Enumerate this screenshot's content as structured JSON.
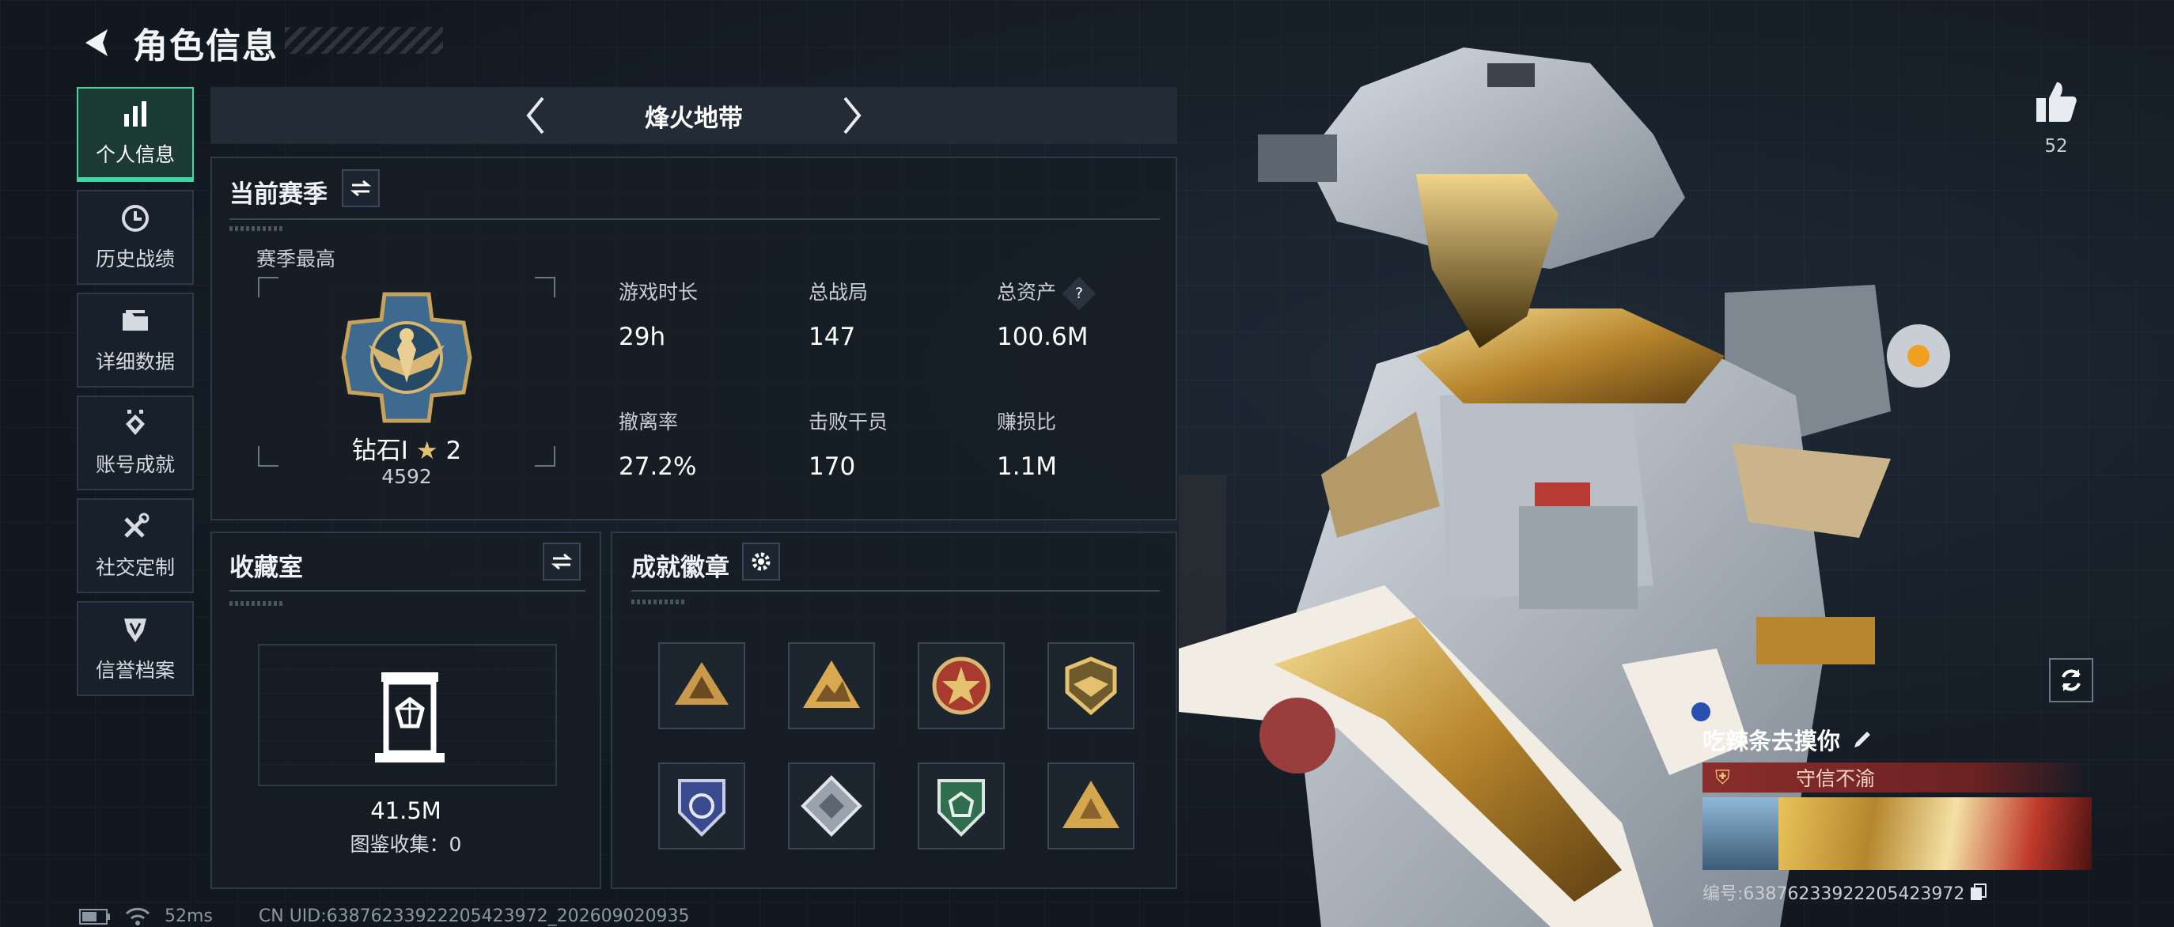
{
  "header": {
    "title": "角色信息"
  },
  "sidebar": {
    "items": [
      {
        "label": "个人信息",
        "icon": "bar-chart-icon",
        "active": true
      },
      {
        "label": "历史战绩",
        "icon": "history-icon"
      },
      {
        "label": "详细数据",
        "icon": "folder-icon"
      },
      {
        "label": "账号成就",
        "icon": "achievement-icon"
      },
      {
        "label": "社交定制",
        "icon": "tools-icon"
      },
      {
        "label": "信誉档案",
        "icon": "shield-icon"
      }
    ]
  },
  "mode": {
    "name": "烽火地带"
  },
  "season": {
    "title": "当前赛季",
    "best_label": "赛季最高",
    "rank_name": "钻石Ⅰ",
    "rank_stars": "2",
    "rank_score": "4592",
    "stats": [
      {
        "label": "游戏时长",
        "value": "29h"
      },
      {
        "label": "总战局",
        "value": "147"
      },
      {
        "label": "总资产",
        "value": "100.6M"
      },
      {
        "label": "撤离率",
        "value": "27.2%"
      },
      {
        "label": "击败干员",
        "value": "170"
      },
      {
        "label": "赚损比",
        "value": "1.1M"
      }
    ],
    "help_glyph": "?"
  },
  "collection": {
    "title": "收藏室",
    "value": "41.5M",
    "codex_text": "图鉴收集：0"
  },
  "achievements": {
    "title": "成就徽章",
    "badges": [
      "triangle-badge-icon",
      "mountain-badge-icon",
      "star-emblem-icon",
      "gold-wing-badge-icon",
      "blue-shield-badge-icon",
      "diamond-badge-icon",
      "green-shield-badge-icon",
      "gold-triangle-badge-icon"
    ]
  },
  "player": {
    "likes": "52",
    "name": "吃辣条去摸你",
    "title": "守信不渝",
    "uid_text": "编号:6387623392220542397​2"
  },
  "footer": {
    "ping": "52ms",
    "uid": "CN UID:6387623392220542397​2_202609020935"
  },
  "colors": {
    "accent": "#3fd6a1",
    "panel": "#161d25",
    "title_bar": "#8a2d2d"
  }
}
